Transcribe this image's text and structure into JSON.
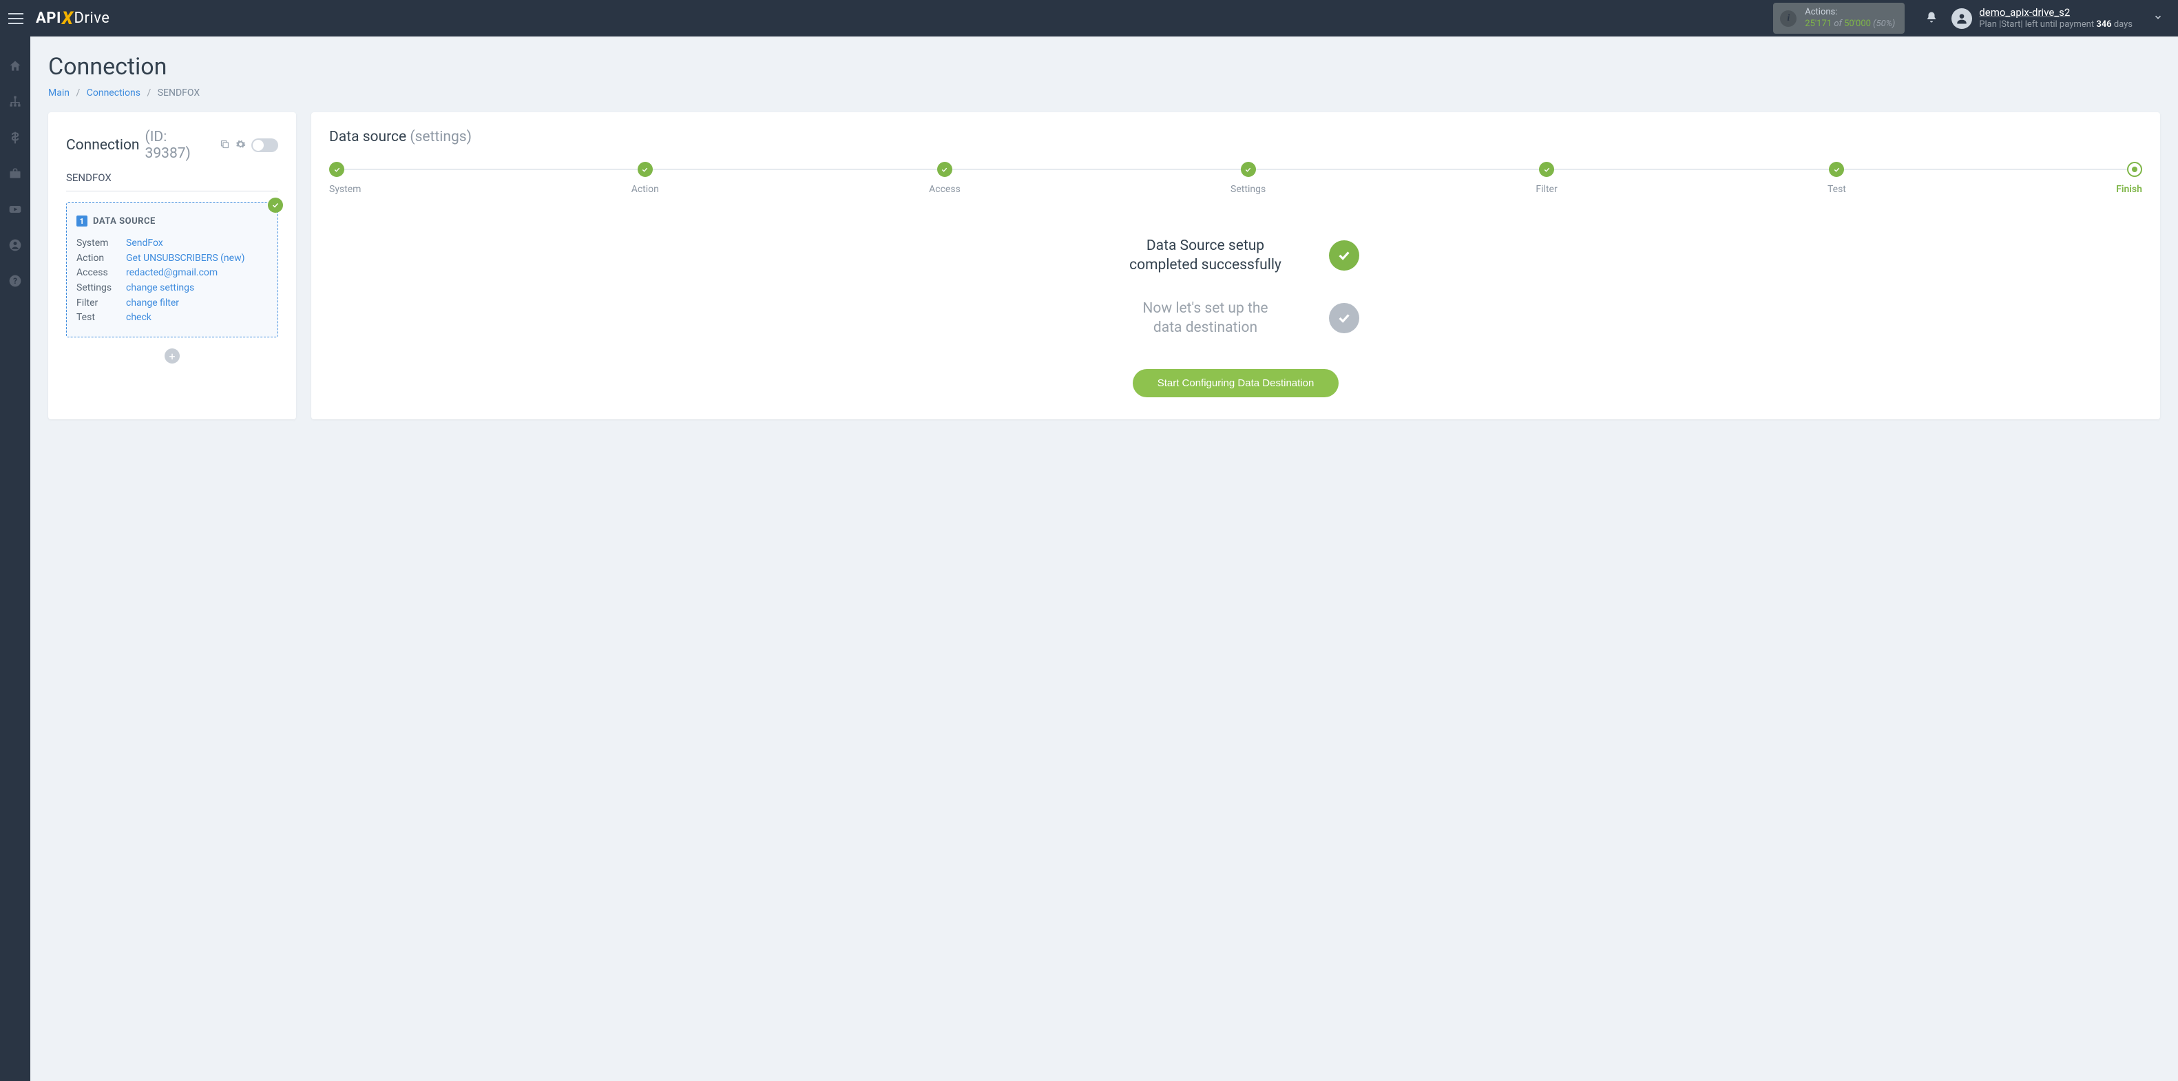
{
  "topbar": {
    "logo": {
      "api": "API",
      "x": "X",
      "drive": "Drive"
    },
    "actions": {
      "label": "Actions:",
      "count": "25'171",
      "of": "of",
      "total": "50'000",
      "pct": "(50%)"
    },
    "user": {
      "name": "demo_apix-drive_s2",
      "plan_prefix": "Plan |Start| left until payment ",
      "days": "346",
      "days_suffix": " days"
    }
  },
  "page": {
    "title": "Connection",
    "breadcrumb": {
      "main": "Main",
      "connections": "Connections",
      "current": "SENDFOX"
    }
  },
  "left": {
    "header_label": "Connection",
    "header_id": "(ID: 39387)",
    "name": "SENDFOX",
    "ds": {
      "badge": "1",
      "title": "DATA SOURCE",
      "rows": {
        "system_k": "System",
        "system_v": "SendFox",
        "action_k": "Action",
        "action_v": "Get UNSUBSCRIBERS (new)",
        "access_k": "Access",
        "access_v_prefix": "redacted",
        "access_v_suffix": "@gmail.com",
        "settings_k": "Settings",
        "settings_v": "change settings",
        "filter_k": "Filter",
        "filter_v": "change filter",
        "test_k": "Test",
        "test_v": "check"
      }
    }
  },
  "right": {
    "title_main": "Data source",
    "title_sub": "(settings)",
    "steps": [
      "System",
      "Action",
      "Access",
      "Settings",
      "Filter",
      "Test",
      "Finish"
    ],
    "status": {
      "done_line1": "Data Source setup",
      "done_line2": "completed successfully",
      "next_line1": "Now let's set up the",
      "next_line2": "data destination"
    },
    "cta": "Start Configuring Data Destination"
  }
}
